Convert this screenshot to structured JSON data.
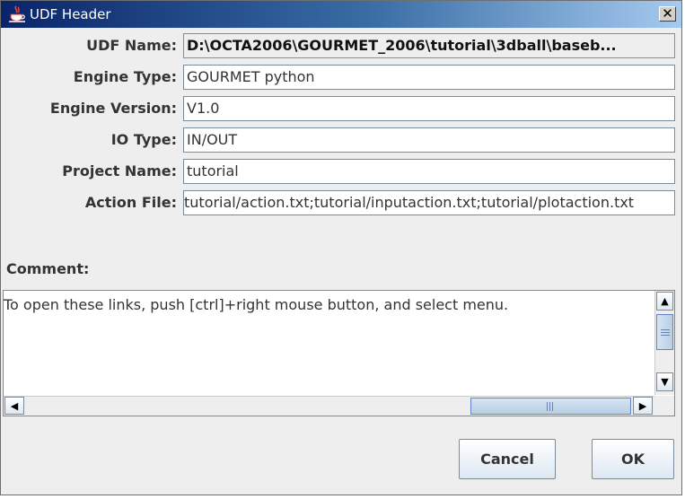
{
  "window": {
    "title": "UDF Header",
    "close_glyph": "✕"
  },
  "fields": [
    {
      "key": "udf_name",
      "label": "UDF Name:",
      "value": "D:\\OCTA2006\\GOURMET_2006\\tutorial\\3dball\\baseb..."
    },
    {
      "key": "engine_type",
      "label": "Engine Type:",
      "value": "GOURMET python"
    },
    {
      "key": "engine_version",
      "label": "Engine Version:",
      "value": "V1.0"
    },
    {
      "key": "io_type",
      "label": "IO Type:",
      "value": "IN/OUT"
    },
    {
      "key": "project_name",
      "label": "Project Name:",
      "value": "tutorial"
    },
    {
      "key": "action_file",
      "label": "Action File:",
      "value": "tutorial/action.txt;tutorial/inputaction.txt;tutorial/plotaction.txt"
    }
  ],
  "comment": {
    "label": "Comment:",
    "text": "To open these links, push [ctrl]+right mouse button, and select menu."
  },
  "buttons": {
    "cancel": "Cancel",
    "ok": "OK"
  },
  "icons": {
    "app": "java-coffee-cup-icon",
    "close": "close-icon",
    "scroll_up": "arrow-up-icon",
    "scroll_down": "arrow-down-icon",
    "scroll_left": "arrow-left-icon",
    "scroll_right": "arrow-right-icon"
  },
  "colors": {
    "titlebar_start": "#0a246a",
    "titlebar_end": "#a6caf0",
    "dialog_bg": "#eeeeee",
    "scroll_accent": "#b8cfe5"
  }
}
